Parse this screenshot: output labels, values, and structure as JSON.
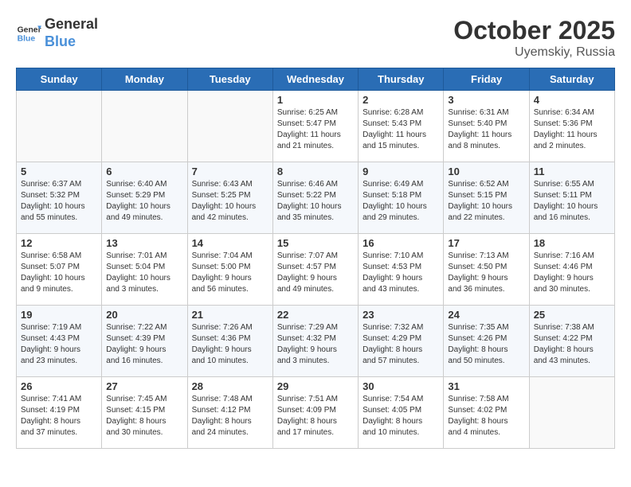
{
  "header": {
    "logo_line1": "General",
    "logo_line2": "Blue",
    "month": "October 2025",
    "location": "Uyemskiy, Russia"
  },
  "weekdays": [
    "Sunday",
    "Monday",
    "Tuesday",
    "Wednesday",
    "Thursday",
    "Friday",
    "Saturday"
  ],
  "weeks": [
    [
      {
        "day": "",
        "info": ""
      },
      {
        "day": "",
        "info": ""
      },
      {
        "day": "",
        "info": ""
      },
      {
        "day": "1",
        "info": "Sunrise: 6:25 AM\nSunset: 5:47 PM\nDaylight: 11 hours\nand 21 minutes."
      },
      {
        "day": "2",
        "info": "Sunrise: 6:28 AM\nSunset: 5:43 PM\nDaylight: 11 hours\nand 15 minutes."
      },
      {
        "day": "3",
        "info": "Sunrise: 6:31 AM\nSunset: 5:40 PM\nDaylight: 11 hours\nand 8 minutes."
      },
      {
        "day": "4",
        "info": "Sunrise: 6:34 AM\nSunset: 5:36 PM\nDaylight: 11 hours\nand 2 minutes."
      }
    ],
    [
      {
        "day": "5",
        "info": "Sunrise: 6:37 AM\nSunset: 5:32 PM\nDaylight: 10 hours\nand 55 minutes."
      },
      {
        "day": "6",
        "info": "Sunrise: 6:40 AM\nSunset: 5:29 PM\nDaylight: 10 hours\nand 49 minutes."
      },
      {
        "day": "7",
        "info": "Sunrise: 6:43 AM\nSunset: 5:25 PM\nDaylight: 10 hours\nand 42 minutes."
      },
      {
        "day": "8",
        "info": "Sunrise: 6:46 AM\nSunset: 5:22 PM\nDaylight: 10 hours\nand 35 minutes."
      },
      {
        "day": "9",
        "info": "Sunrise: 6:49 AM\nSunset: 5:18 PM\nDaylight: 10 hours\nand 29 minutes."
      },
      {
        "day": "10",
        "info": "Sunrise: 6:52 AM\nSunset: 5:15 PM\nDaylight: 10 hours\nand 22 minutes."
      },
      {
        "day": "11",
        "info": "Sunrise: 6:55 AM\nSunset: 5:11 PM\nDaylight: 10 hours\nand 16 minutes."
      }
    ],
    [
      {
        "day": "12",
        "info": "Sunrise: 6:58 AM\nSunset: 5:07 PM\nDaylight: 10 hours\nand 9 minutes."
      },
      {
        "day": "13",
        "info": "Sunrise: 7:01 AM\nSunset: 5:04 PM\nDaylight: 10 hours\nand 3 minutes."
      },
      {
        "day": "14",
        "info": "Sunrise: 7:04 AM\nSunset: 5:00 PM\nDaylight: 9 hours\nand 56 minutes."
      },
      {
        "day": "15",
        "info": "Sunrise: 7:07 AM\nSunset: 4:57 PM\nDaylight: 9 hours\nand 49 minutes."
      },
      {
        "day": "16",
        "info": "Sunrise: 7:10 AM\nSunset: 4:53 PM\nDaylight: 9 hours\nand 43 minutes."
      },
      {
        "day": "17",
        "info": "Sunrise: 7:13 AM\nSunset: 4:50 PM\nDaylight: 9 hours\nand 36 minutes."
      },
      {
        "day": "18",
        "info": "Sunrise: 7:16 AM\nSunset: 4:46 PM\nDaylight: 9 hours\nand 30 minutes."
      }
    ],
    [
      {
        "day": "19",
        "info": "Sunrise: 7:19 AM\nSunset: 4:43 PM\nDaylight: 9 hours\nand 23 minutes."
      },
      {
        "day": "20",
        "info": "Sunrise: 7:22 AM\nSunset: 4:39 PM\nDaylight: 9 hours\nand 16 minutes."
      },
      {
        "day": "21",
        "info": "Sunrise: 7:26 AM\nSunset: 4:36 PM\nDaylight: 9 hours\nand 10 minutes."
      },
      {
        "day": "22",
        "info": "Sunrise: 7:29 AM\nSunset: 4:32 PM\nDaylight: 9 hours\nand 3 minutes."
      },
      {
        "day": "23",
        "info": "Sunrise: 7:32 AM\nSunset: 4:29 PM\nDaylight: 8 hours\nand 57 minutes."
      },
      {
        "day": "24",
        "info": "Sunrise: 7:35 AM\nSunset: 4:26 PM\nDaylight: 8 hours\nand 50 minutes."
      },
      {
        "day": "25",
        "info": "Sunrise: 7:38 AM\nSunset: 4:22 PM\nDaylight: 8 hours\nand 43 minutes."
      }
    ],
    [
      {
        "day": "26",
        "info": "Sunrise: 7:41 AM\nSunset: 4:19 PM\nDaylight: 8 hours\nand 37 minutes."
      },
      {
        "day": "27",
        "info": "Sunrise: 7:45 AM\nSunset: 4:15 PM\nDaylight: 8 hours\nand 30 minutes."
      },
      {
        "day": "28",
        "info": "Sunrise: 7:48 AM\nSunset: 4:12 PM\nDaylight: 8 hours\nand 24 minutes."
      },
      {
        "day": "29",
        "info": "Sunrise: 7:51 AM\nSunset: 4:09 PM\nDaylight: 8 hours\nand 17 minutes."
      },
      {
        "day": "30",
        "info": "Sunrise: 7:54 AM\nSunset: 4:05 PM\nDaylight: 8 hours\nand 10 minutes."
      },
      {
        "day": "31",
        "info": "Sunrise: 7:58 AM\nSunset: 4:02 PM\nDaylight: 8 hours\nand 4 minutes."
      },
      {
        "day": "",
        "info": ""
      }
    ]
  ]
}
